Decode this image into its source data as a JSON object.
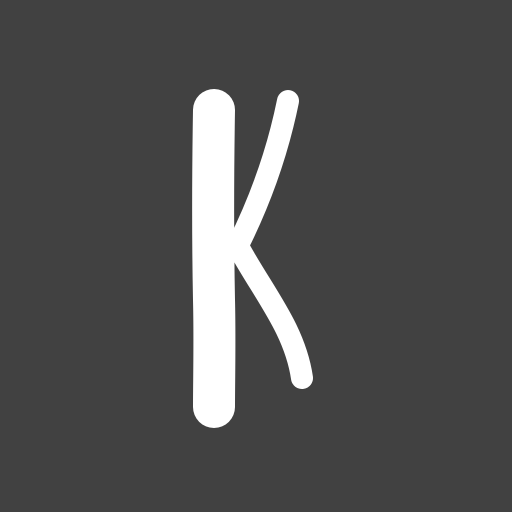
{
  "logo": {
    "letter": "K",
    "icon": "letter-k-logo-icon",
    "background_color": "#414141",
    "foreground_color": "#ffffff"
  }
}
